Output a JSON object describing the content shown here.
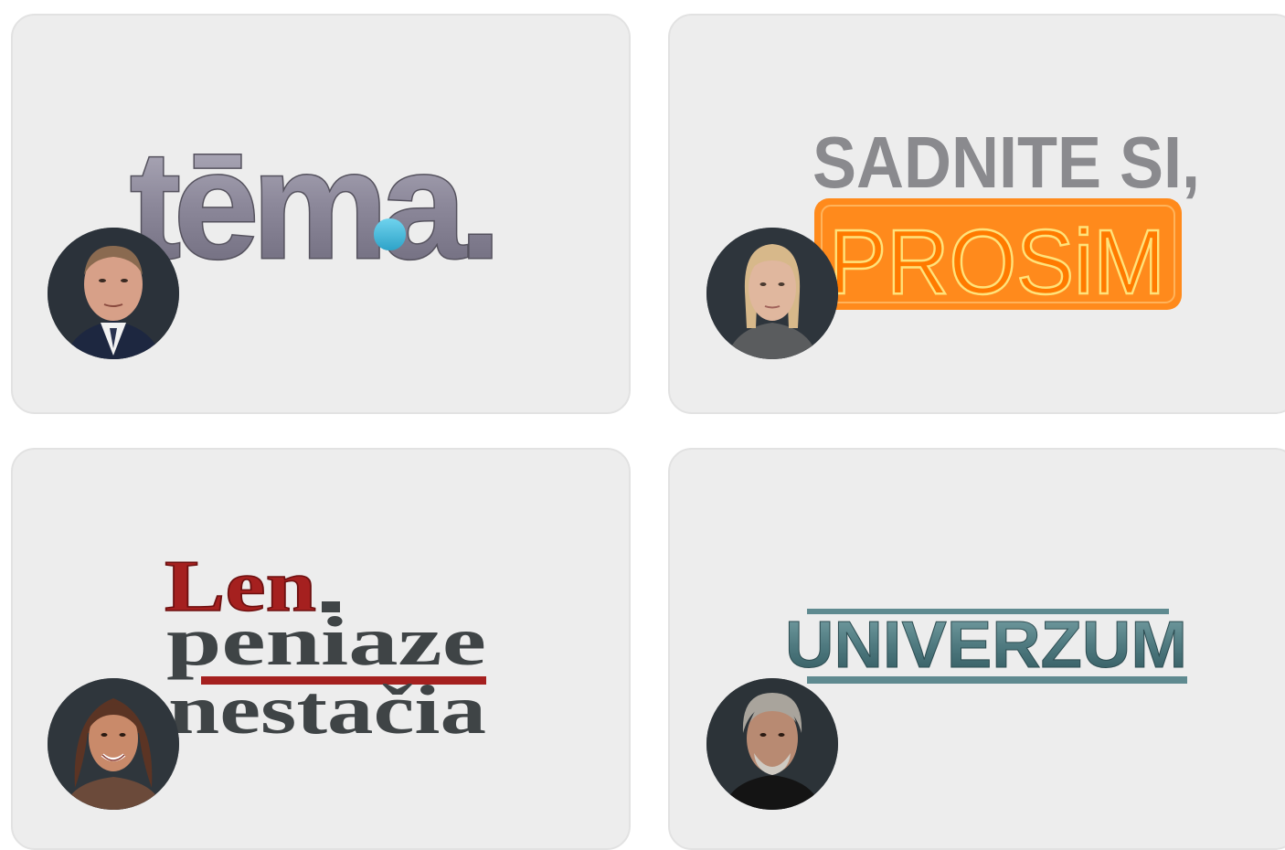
{
  "shows": [
    {
      "id": "tema",
      "logo_text": "tēma."
    },
    {
      "id": "sadnite",
      "logo_line1": "SADNITE SI,",
      "logo_line2": "PROSiM"
    },
    {
      "id": "len-peniaze",
      "logo_line1": "Len",
      "logo_line2": "peniaze",
      "logo_line3": "nestačia"
    },
    {
      "id": "univerzum",
      "logo_text": "UNIVERZUM"
    }
  ],
  "colors": {
    "card_bg": "#ededed",
    "tema_silver": "#8e8a9c",
    "tema_blue": "#3fb8d8",
    "sadnite_grey": "#8a8a8e",
    "prosim_orange": "#ff8a1c",
    "len_red": "#a5201f",
    "len_dark": "#3f4446",
    "univerzum_teal": "#4f7a80"
  },
  "icons": [
    "host-avatar-male",
    "host-avatar-female",
    "host-avatar-female-2",
    "host-avatar-male-2"
  ]
}
